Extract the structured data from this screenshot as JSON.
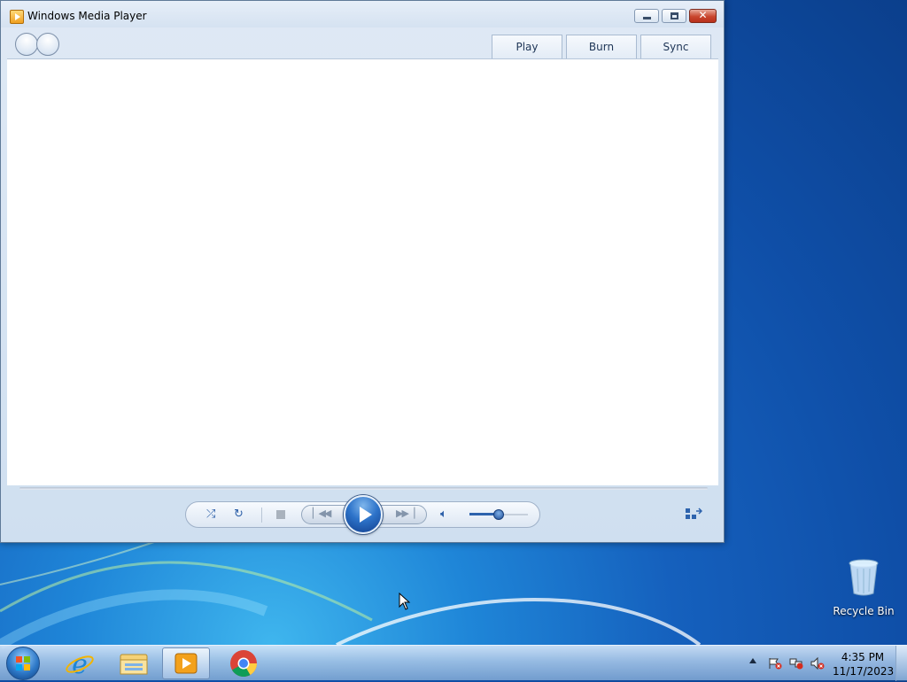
{
  "window": {
    "title": "Windows Media Player",
    "tabs": [
      {
        "label": "Play"
      },
      {
        "label": "Burn"
      },
      {
        "label": "Sync"
      }
    ],
    "volume_level": 0.5
  },
  "desktop": {
    "recycle_bin_label": "Recycle Bin"
  },
  "taskbar": {
    "pinned": [
      "internet-explorer-icon",
      "windows-explorer-icon",
      "windows-media-player-icon",
      "chrome-icon"
    ],
    "clock": {
      "time": "4:35 PM",
      "date": "11/17/2023"
    }
  },
  "colors": {
    "accent_blue": "#2d63ad",
    "desktop_blue": "#1560bd",
    "close_red": "#c9462e"
  }
}
